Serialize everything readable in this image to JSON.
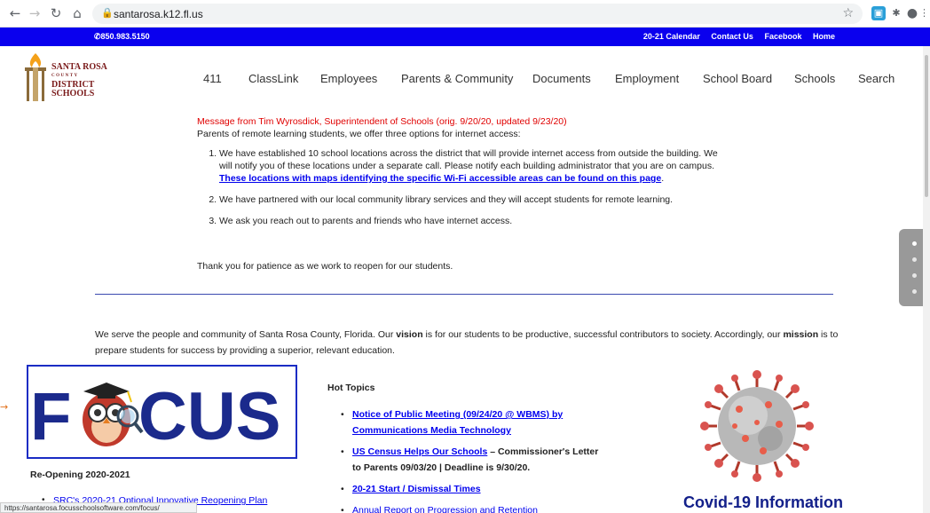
{
  "browser": {
    "url": "santarosa.k12.fl.us",
    "back_icon": "arrow-left",
    "forward_icon": "arrow-right",
    "reload_icon": "reload",
    "home_icon": "home",
    "lock_icon": "lock",
    "star_icon": "star",
    "status_url": "https://santarosa.focusschoolsoftware.com/focus/"
  },
  "topbar": {
    "phone": "850.983.5150",
    "links": [
      "20-21 Calendar",
      "Contact Us",
      "Facebook",
      "Home"
    ]
  },
  "logo": {
    "line1": "SANTA ROSA",
    "line2": "COUNTY",
    "line3": "DISTRICT",
    "line4": "SCHOOLS"
  },
  "nav": [
    "411",
    "ClassLink",
    "Employees",
    "Parents & Community",
    "Documents",
    "Employment",
    "School Board",
    "Schools",
    "Search"
  ],
  "message": {
    "title": "Message from Tim Wyrosdick, Superintendent of Schools (orig. 9/20/20, updated 9/23/20)",
    "intro": "Parents of remote learning students, we offer three options for internet access:",
    "item1_text": "We have established 10 school locations across the district that will provide internet access from outside the building. We will notify you of these locations under a separate call. Please notify each building administrator that you are on campus. ",
    "item1_link": "These locations with maps identifying the specific Wi-Fi accessible areas can be found on this page",
    "item1_end": ".",
    "item2": "We have partnered with our local community library services and they will accept students for remote learning.",
    "item3": "We ask you reach out to parents and friends who have internet access.",
    "thanks": "Thank you for patience as we work to reopen for our students."
  },
  "vision": {
    "part1": "We serve the people and community of Santa Rosa County, Florida. Our ",
    "vision_word": "vision",
    "part2": " is for our students to be productive, successful contributors to society. Accordingly, our ",
    "mission_word": "mission",
    "part3": " is to prepare students for success by providing a superior, relevant education."
  },
  "focus": {
    "logo_letters_left": "F",
    "logo_letters_right": "CUS",
    "reopen_title": "Re-Opening 2020-2021",
    "reopen_link": "SRC's 2020-21 Optional Innovative Reopening Plan"
  },
  "hot_topics": {
    "title": "Hot Topics",
    "item1_link": "Notice of Public Meeting (09/24/20 @ WBMS) by Communications Media Technology",
    "item2_link": "US Census Helps Our Schools",
    "item2_text": " – Commissioner's Letter to Parents 09/03/20 | Deadline is 9/30/20.",
    "item3_link": "20-21 Start / Dismissal Times",
    "item4_link": "Annual Report on Progression and Retention"
  },
  "covid": {
    "title": "Covid-19 Information"
  },
  "colors": {
    "topbar": "#0a00ee",
    "message_red": "#e00000",
    "link": "#0000ee",
    "covid_title": "#13208a",
    "focus_blue": "#1b2a8c"
  }
}
